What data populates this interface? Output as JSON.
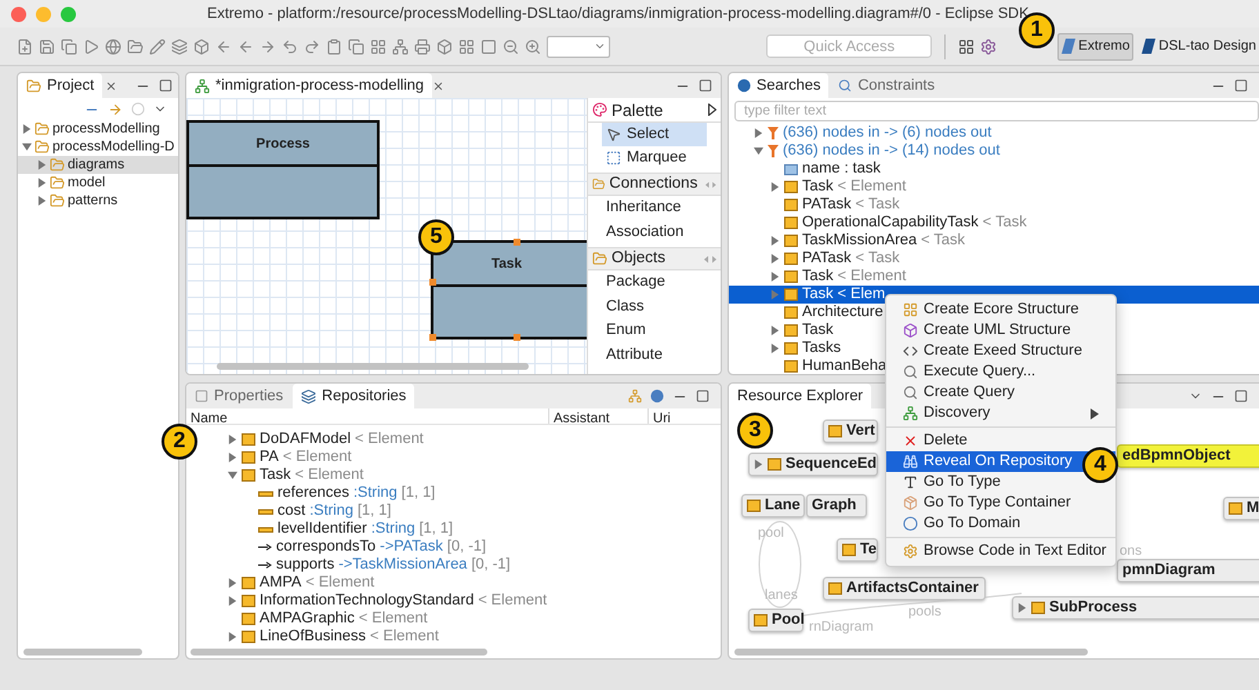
{
  "window": {
    "title": "Extremo - platform:/resource/processModelling-DSLtao/diagrams/inmigration-process-modelling.diagram#/0 - Eclipse SDK"
  },
  "toolbar": {
    "quick_access": {
      "placeholder": "Quick Access"
    },
    "perspectives": [
      {
        "label": "Extremo",
        "selected": true
      },
      {
        "label": "DSL-tao Design",
        "selected": false
      }
    ]
  },
  "project": {
    "tab": "Project",
    "tree": [
      {
        "label": "processModelling",
        "expanded": false,
        "selected": false
      },
      {
        "label": "processModelling-D",
        "expanded": true,
        "selected": false,
        "children": [
          {
            "label": "diagrams",
            "expanded": false,
            "selected": true
          },
          {
            "label": "model",
            "expanded": false,
            "selected": false
          },
          {
            "label": "patterns",
            "expanded": false,
            "selected": false
          }
        ]
      }
    ]
  },
  "editor": {
    "tab": "*inmigration-process-modelling",
    "nodes": [
      {
        "name": "Process",
        "selected": false
      },
      {
        "name": "Task",
        "selected": true
      }
    ],
    "palette": {
      "title": "Palette",
      "tools": [
        {
          "label": "Select",
          "selected": true
        },
        {
          "label": "Marquee",
          "selected": false
        }
      ],
      "drawers": [
        {
          "label": "Connections",
          "items": [
            "Inheritance",
            "Association"
          ]
        },
        {
          "label": "Objects",
          "items": [
            "Package",
            "Class",
            "Enum",
            "Attribute"
          ]
        }
      ]
    }
  },
  "searches": {
    "tabs": [
      {
        "label": "Searches",
        "selected": true
      },
      {
        "label": "Constraints",
        "selected": false
      }
    ],
    "filter": {
      "placeholder": "type filter text"
    },
    "tree": [
      {
        "kind": "filter",
        "name": "(636) nodes in -> (6) nodes out",
        "expanded": false,
        "selected": false
      },
      {
        "kind": "filter",
        "name": "(636) nodes in -> (14) nodes out",
        "expanded": true,
        "selected": false,
        "children": [
          {
            "kind": "attribute",
            "name": "name : task",
            "selected": false
          },
          {
            "kind": "class",
            "name": "Task",
            "supertype": "< Element",
            "expanded": false,
            "selected": false
          },
          {
            "kind": "class",
            "name": "PATask",
            "supertype": "< Task",
            "selected": false
          },
          {
            "kind": "class",
            "name": "OperationalCapabilityTask",
            "supertype": "< Task",
            "selected": false
          },
          {
            "kind": "class",
            "name": "TaskMissionArea",
            "supertype": "< Task",
            "expanded": false,
            "selected": false
          },
          {
            "kind": "class",
            "name": "PATask",
            "supertype": "< Task",
            "expanded": false,
            "selected": false
          },
          {
            "kind": "class",
            "name": "Task",
            "supertype": "< Element",
            "expanded": false,
            "selected": false
          },
          {
            "kind": "class",
            "name": "Task",
            "supertype": "< Elem",
            "expanded": false,
            "selected": true
          },
          {
            "kind": "class",
            "name": "Architecture",
            "selected": false
          },
          {
            "kind": "class",
            "name": "Task",
            "expanded": false,
            "selected": false
          },
          {
            "kind": "class",
            "name": "Tasks",
            "expanded": false,
            "selected": false
          },
          {
            "kind": "class",
            "name": "HumanBeha",
            "selected": false
          }
        ]
      }
    ]
  },
  "repositories": {
    "tabs": [
      {
        "label": "Properties",
        "selected": false
      },
      {
        "label": "Repositories",
        "selected": true
      }
    ],
    "columns": [
      "Name",
      "Assistant",
      "Uri"
    ],
    "rows": [
      {
        "kind": "class",
        "name": "DoDAFModel",
        "supertype": "< Element",
        "expanded": false
      },
      {
        "kind": "class",
        "name": "PA",
        "supertype": "< Element",
        "expanded": false
      },
      {
        "kind": "class",
        "name": "Task",
        "supertype": "< Element",
        "expanded": true,
        "children": [
          {
            "kind": "attribute",
            "name": "references",
            "type": ":String",
            "bounds": "[1, 1]"
          },
          {
            "kind": "attribute",
            "name": "cost",
            "type": ":String",
            "bounds": "[1, 1]"
          },
          {
            "kind": "attribute",
            "name": "levelIdentifier",
            "type": ":String",
            "bounds": "[1, 1]"
          },
          {
            "kind": "reference",
            "name": "correspondsTo",
            "type": "->PATask",
            "bounds": "[0, -1]"
          },
          {
            "kind": "reference",
            "name": "supports",
            "type": "->TaskMissionArea",
            "bounds": "[0, -1]"
          }
        ]
      },
      {
        "kind": "class",
        "name": "AMPA",
        "supertype": "< Element",
        "expanded": false
      },
      {
        "kind": "class",
        "name": "InformationTechnologyStandard",
        "supertype": "< Element",
        "expanded": false
      },
      {
        "kind": "class",
        "name": "AMPAGraphic",
        "supertype": "< Element"
      },
      {
        "kind": "class",
        "name": "LineOfBusiness",
        "supertype": "< Element",
        "expanded": false
      }
    ]
  },
  "resource_explorer": {
    "tab": "Resource Explorer",
    "nodes": [
      {
        "label": "Vert",
        "kind": "plain"
      },
      {
        "label": "SequenceEd",
        "kind": "expandable"
      },
      {
        "label": "Lane",
        "kind": "plain"
      },
      {
        "label": "Graph",
        "kind": "bare"
      },
      {
        "label": "Te",
        "kind": "plain"
      },
      {
        "label": "ArtifactsContainer",
        "kind": "plain"
      },
      {
        "label": "Pool",
        "kind": "plain"
      },
      {
        "label": "edBpmnObject",
        "kind": "highlight"
      },
      {
        "label": "M",
        "kind": "plain"
      },
      {
        "label": "pmnDiagram",
        "kind": "bare"
      },
      {
        "label": "SubProcess",
        "kind": "expandable"
      }
    ],
    "edge_labels": [
      "pool",
      "lanes",
      "rnDiagram",
      "pools",
      "ons"
    ]
  },
  "context_menu": {
    "items": [
      {
        "kind": "item",
        "label": "Create Ecore Structure",
        "selected": false
      },
      {
        "kind": "item",
        "label": "Create UML Structure",
        "selected": false
      },
      {
        "kind": "item",
        "label": "Create Exeed Structure",
        "selected": false
      },
      {
        "kind": "item",
        "label": "Execute Query...",
        "selected": false
      },
      {
        "kind": "item",
        "label": "Create Query",
        "selected": false
      },
      {
        "kind": "submenu",
        "label": "Discovery",
        "selected": false
      },
      {
        "kind": "separator"
      },
      {
        "kind": "item",
        "label": "Delete",
        "selected": false
      },
      {
        "kind": "item",
        "label": "Reveal On Repository",
        "selected": true
      },
      {
        "kind": "item",
        "label": "Go To Type",
        "selected": false
      },
      {
        "kind": "item",
        "label": "Go To Type Container",
        "selected": false
      },
      {
        "kind": "item",
        "label": "Go To Domain",
        "selected": false
      },
      {
        "kind": "separator"
      },
      {
        "kind": "item",
        "label": "Browse Code in Text Editor",
        "selected": false
      }
    ]
  },
  "callouts": [
    "1",
    "2",
    "3",
    "4",
    "5"
  ]
}
